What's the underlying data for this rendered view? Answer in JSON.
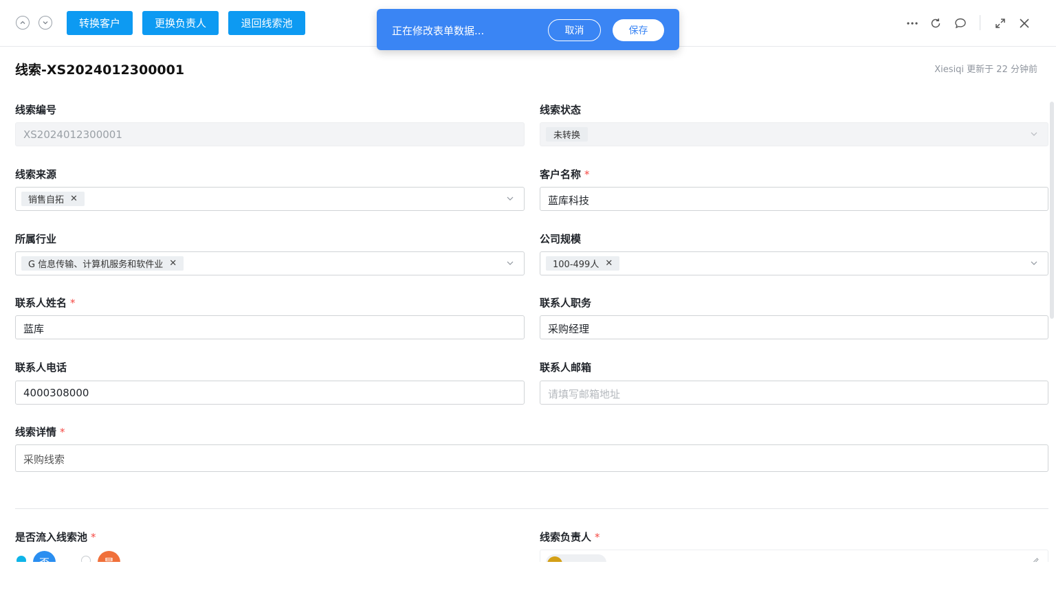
{
  "toolbar": {
    "convert_customer": "转换客户",
    "change_owner": "更换负责人",
    "return_pool": "退回线索池"
  },
  "notification": {
    "message": "正在修改表单数据...",
    "cancel": "取消",
    "save": "保存"
  },
  "header": {
    "title": "线索-XS2024012300001",
    "updated": "Xiesiqi 更新于 22 分钟前"
  },
  "form": {
    "lead_no": {
      "label": "线索编号",
      "value": "XS2024012300001"
    },
    "lead_status": {
      "label": "线索状态",
      "value": "未转换"
    },
    "lead_source": {
      "label": "线索来源",
      "value": "销售自拓"
    },
    "customer_name": {
      "label": "客户名称",
      "value": "蓝库科技"
    },
    "industry": {
      "label": "所属行业",
      "value": "G 信息传输、计算机服务和软件业"
    },
    "company_size": {
      "label": "公司规模",
      "value": "100-499人"
    },
    "contact_name": {
      "label": "联系人姓名",
      "value": "蓝库"
    },
    "contact_title": {
      "label": "联系人职务",
      "value": "采购经理"
    },
    "contact_phone": {
      "label": "联系人电话",
      "value": "4000308000"
    },
    "contact_email": {
      "label": "联系人邮箱",
      "placeholder": "请填写邮箱地址"
    },
    "lead_detail": {
      "label": "线索详情",
      "value": "采购线索"
    },
    "flow_to_pool": {
      "label": "是否流入线索池",
      "option_no": "否",
      "option_yes": "是"
    },
    "lead_owner": {
      "label": "线索负责人"
    },
    "required_mark": "*"
  },
  "colors": {
    "primary_button": "#0d9af2",
    "notification_bg": "#3a85f4",
    "required": "#f54a45"
  }
}
